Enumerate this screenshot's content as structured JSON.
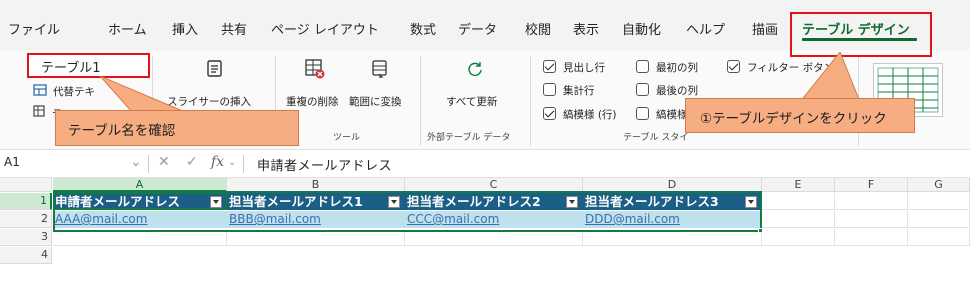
{
  "tabs": [
    {
      "label": "ファイル"
    },
    {
      "label": "ホーム"
    },
    {
      "label": "挿入"
    },
    {
      "label": "共有"
    },
    {
      "label": "ページ レイアウト"
    },
    {
      "label": "数式"
    },
    {
      "label": "データ"
    },
    {
      "label": "校閲"
    },
    {
      "label": "表示"
    },
    {
      "label": "自動化"
    },
    {
      "label": "ヘルプ"
    },
    {
      "label": "描画"
    },
    {
      "label": "テーブル デザイン"
    }
  ],
  "properties": {
    "table_name": "テーブル1",
    "convert_label": "代替テキ",
    "third_label": "テ"
  },
  "tools": {
    "slicer_label": "スライサーの挿入",
    "remove_dup_label": "重複の削除",
    "convert_range_label": "範囲に変換",
    "group_label": "ツール"
  },
  "external": {
    "refresh_label": "すべて更新",
    "group_label": "外部テーブル データ"
  },
  "style_options": {
    "header_row": "見出し行",
    "total_row": "集計行",
    "banded_rows": "縞模様 (行)",
    "first_column": "最初の列",
    "last_column": "最後の列",
    "banded_cols": "縞模様",
    "filter_button": "フィルター ボタン",
    "group_label": "テーブル スタイ"
  },
  "callouts": {
    "table_name_note": "テーブル名を確認",
    "design_note": "①テーブルデザインをクリック"
  },
  "formula_bar": {
    "cell_ref": "A1",
    "fx": "fx",
    "content": "申請者メールアドレス"
  },
  "columns": [
    "A",
    "B",
    "C",
    "D",
    "E",
    "F",
    "G"
  ],
  "rows": [
    "1",
    "2",
    "3",
    "4"
  ],
  "table": {
    "headers": [
      "申請者メールアドレス",
      "担当者メールアドレス1",
      "担当者メールアドレス2",
      "担当者メールアドレス3"
    ],
    "data": [
      "AAA@mail.com",
      "BBB@mail.com",
      "CCC@mail.com",
      "DDD@mail.com"
    ]
  },
  "colors": {
    "accent": "#107c41",
    "header_fill": "#1c5f86",
    "band_fill": "#bfe1ed",
    "annotation_red": "#e0151c",
    "callout_fill": "#f6ad82"
  }
}
